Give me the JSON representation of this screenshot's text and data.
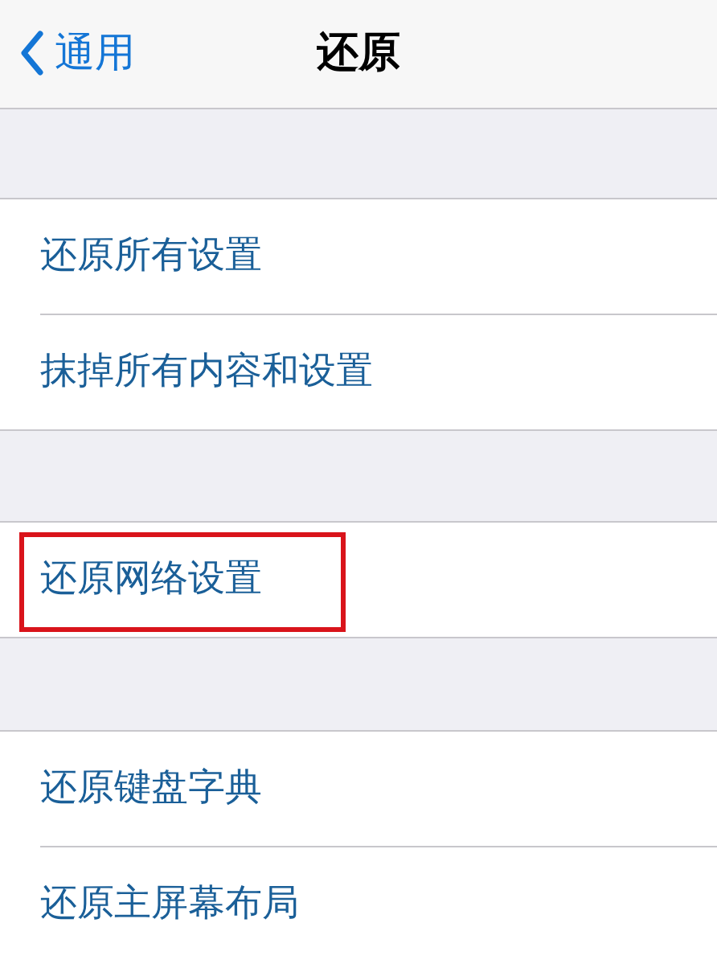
{
  "nav_bar": {
    "back_label": "通用",
    "title": "还原"
  },
  "groups": [
    {
      "rows": [
        {
          "label": "还原所有设置",
          "highlighted": false
        },
        {
          "label": "抹掉所有内容和设置",
          "highlighted": false
        }
      ]
    },
    {
      "rows": [
        {
          "label": "还原网络设置",
          "highlighted": true
        }
      ]
    },
    {
      "rows": [
        {
          "label": "还原键盘字典",
          "highlighted": false
        },
        {
          "label": "还原主屏幕布局",
          "highlighted": false
        }
      ]
    }
  ]
}
